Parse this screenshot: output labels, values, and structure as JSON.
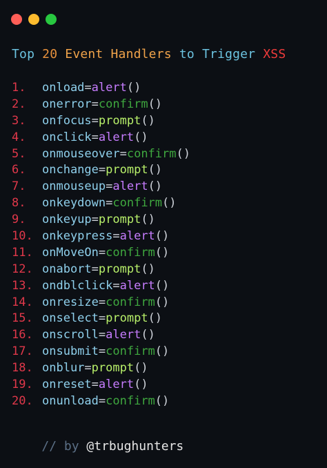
{
  "window": {
    "buttons": [
      {
        "name": "close",
        "color": "#ff5f57"
      },
      {
        "name": "minimize",
        "color": "#febc2e"
      },
      {
        "name": "zoom",
        "color": "#28c840"
      }
    ]
  },
  "title": {
    "parts": [
      {
        "text": "Top ",
        "color": "#6cc3e0"
      },
      {
        "text": "20 ",
        "color": "#e8913c"
      },
      {
        "text": "Event Handlers ",
        "color": "#f0a34a"
      },
      {
        "text": "to Trigger ",
        "color": "#6cc3e0"
      },
      {
        "text": "XSS",
        "color": "#ef3b3b"
      }
    ]
  },
  "colors": {
    "number": "#e0384a",
    "handler": "#8fd0ec",
    "equals": "#cfd3da",
    "alert": "#c77dff",
    "confirm": "#3fa83f",
    "prompt": "#b8f06a",
    "paren": "#cfd3da",
    "comment": "#5b6f86",
    "author": "#e6e6e6"
  },
  "handlers": [
    {
      "num": "1.",
      "handler": "onload",
      "func": "alert"
    },
    {
      "num": "2.",
      "handler": "onerror",
      "func": "confirm"
    },
    {
      "num": "3.",
      "handler": "onfocus",
      "func": "prompt"
    },
    {
      "num": "4.",
      "handler": "onclick",
      "func": "alert"
    },
    {
      "num": "5.",
      "handler": "onmouseover",
      "func": "confirm"
    },
    {
      "num": "6.",
      "handler": "onchange",
      "func": "prompt"
    },
    {
      "num": "7.",
      "handler": "onmouseup",
      "func": "alert"
    },
    {
      "num": "8.",
      "handler": "onkeydown",
      "func": "confirm"
    },
    {
      "num": "9.",
      "handler": "onkeyup",
      "func": "prompt"
    },
    {
      "num": "10.",
      "handler": "onkeypress",
      "func": "alert"
    },
    {
      "num": "11.",
      "handler": "onMoveOn",
      "func": "confirm"
    },
    {
      "num": "12.",
      "handler": "onabort",
      "func": "prompt"
    },
    {
      "num": "13.",
      "handler": "ondblclick",
      "func": "alert"
    },
    {
      "num": "14.",
      "handler": "onresize",
      "func": "confirm"
    },
    {
      "num": "15.",
      "handler": "onselect",
      "func": "prompt"
    },
    {
      "num": "16.",
      "handler": "onscroll",
      "func": "alert"
    },
    {
      "num": "17.",
      "handler": "onsubmit",
      "func": "confirm"
    },
    {
      "num": "18.",
      "handler": "onblur",
      "func": "prompt"
    },
    {
      "num": "19.",
      "handler": "onreset",
      "func": "alert"
    },
    {
      "num": "20.",
      "handler": "onunload",
      "func": "confirm"
    }
  ],
  "syntax": {
    "equals": "=",
    "parens": "()"
  },
  "footer": {
    "comment": "// by ",
    "author": "@trbughunters"
  }
}
